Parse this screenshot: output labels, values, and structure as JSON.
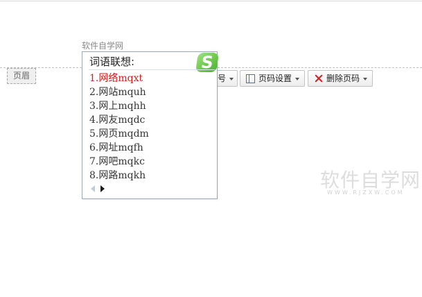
{
  "document": {
    "header_text": "软件自学网",
    "header_tag": "页眉"
  },
  "toolbar": {
    "partial_label": "号",
    "page_settings_label": "页码设置",
    "delete_page_number_label": "删除页码"
  },
  "ime": {
    "title": "词语联想:",
    "logo_glyph": "S",
    "candidates": [
      "1.网络mqxt",
      "2.网站mquh",
      "3.网上mqhh",
      "4.网友mqdc",
      "5.网页mqdm",
      "6.网址mqfh",
      "7.网吧mqkc",
      "8.网路mqkh"
    ]
  },
  "watermark": {
    "main": "软件自学网",
    "sub": "WWW.RJZXW.COM"
  }
}
